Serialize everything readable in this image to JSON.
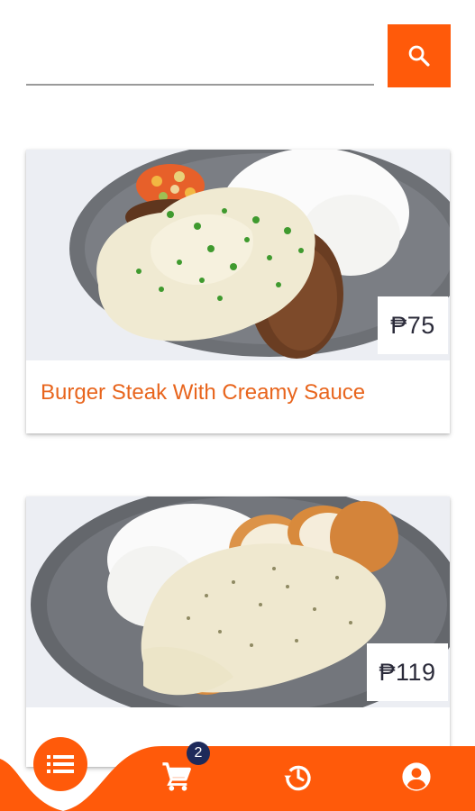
{
  "search": {
    "value": "",
    "placeholder": "",
    "button_icon": "search-icon"
  },
  "products": [
    {
      "title": "Burger Steak With Creamy Sauce",
      "price": "₱75",
      "image": "burger-steak-photo"
    },
    {
      "title": "",
      "price": "₱119",
      "image": "chicken-cordon-bleu-photo"
    }
  ],
  "bottom_nav": {
    "items": [
      {
        "name": "menu",
        "icon": "list-icon",
        "active": true
      },
      {
        "name": "cart",
        "icon": "cart-icon",
        "badge": "2"
      },
      {
        "name": "history",
        "icon": "history-icon"
      },
      {
        "name": "account",
        "icon": "account-icon"
      }
    ]
  },
  "colors": {
    "accent": "#ff5a0a",
    "title_text": "#e8651d",
    "price_text": "#2b2b3a",
    "badge": "#1e2a5a"
  }
}
